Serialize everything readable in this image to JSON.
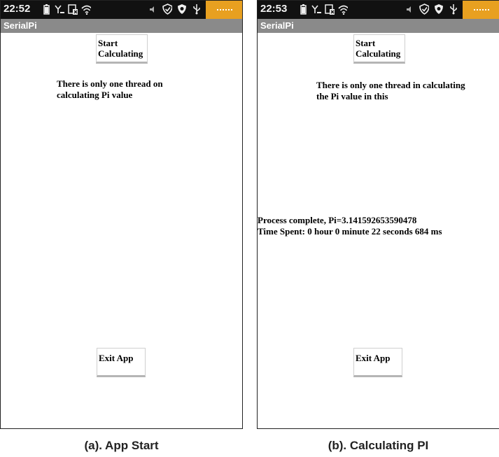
{
  "screens": [
    {
      "status_time": "22:52",
      "app_title": "SerialPi",
      "start_button_label": "Start Calculating",
      "description": "There is only one thread on calculating Pi value",
      "exit_button_label": "Exit App",
      "caption": "(a). App Start"
    },
    {
      "status_time": "22:53",
      "app_title": "SerialPi",
      "start_button_label": "Start Calculating",
      "description": "There is only one thread in calculating the Pi value in this",
      "result_line1": "Process complete, Pi=3.141592653590478",
      "result_line2": "Time Spent: 0 hour 0 minute 22 seconds 684 ms",
      "exit_button_label": "Exit App",
      "caption": "(b). Calculating PI"
    }
  ],
  "status_icons_left": [
    "battery-icon",
    "signal-icon",
    "no-sim-icon",
    "wifi-icon"
  ],
  "status_icons_right": [
    "mute-icon",
    "shield-icon",
    "security-icon",
    "usb-icon"
  ],
  "colors": {
    "status_bar": "#111111",
    "title_bar": "#8a8a8a",
    "notification_tab": "#e8a020",
    "background": "#ffffff"
  }
}
